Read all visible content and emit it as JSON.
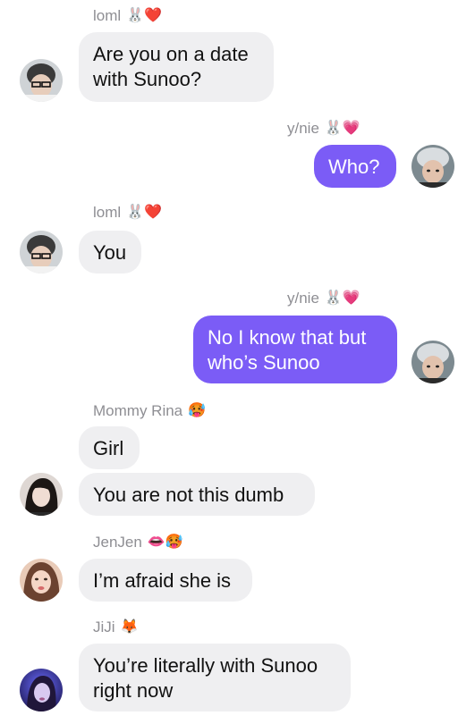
{
  "messages": [
    {
      "sender": "loml",
      "sender_emoji": "🐰❤️",
      "text": "Are you on a date\nwith Sunoo?"
    },
    {
      "sender": "y/nie",
      "sender_emoji": "🐰💗",
      "text": "Who?"
    },
    {
      "sender": "loml",
      "sender_emoji": "🐰❤️",
      "text": "You"
    },
    {
      "sender": "y/nie",
      "sender_emoji": "🐰💗",
      "text": "No I know that but\nwho’s Sunoo"
    },
    {
      "sender": "Mommy Rina",
      "sender_emoji": "🥵",
      "text": "Girl"
    },
    {
      "text": "You are not this dumb"
    },
    {
      "sender": "JenJen",
      "sender_emoji": "👄🥵",
      "text": "I’m afraid she is"
    },
    {
      "sender": "JiJi",
      "sender_emoji": "🦊",
      "text": "You’re literally with Sunoo\nright now"
    }
  ],
  "colors": {
    "outgoing_bubble": "#7b5cf6",
    "incoming_bubble": "#efeff1",
    "sender_name": "#8e8e93"
  }
}
